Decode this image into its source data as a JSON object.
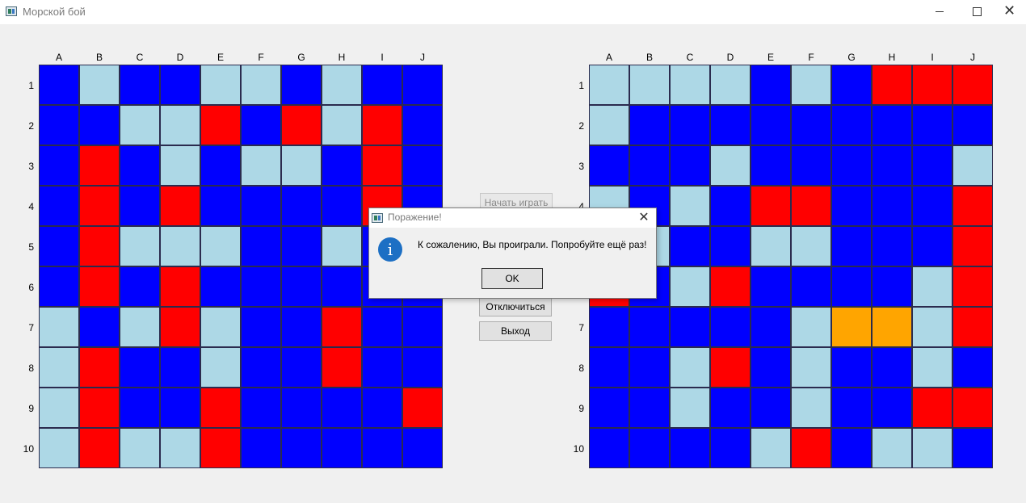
{
  "window": {
    "title": "Морской бой"
  },
  "colors": {
    "water": "#0000ff",
    "miss": "#add8e6",
    "hit": "#ff0000",
    "ship": "#ffa500",
    "background": "#f0f0f0",
    "info": "#1c6fc4"
  },
  "legend": {
    "W": "water",
    "M": "miss",
    "H": "hit",
    "S": "ship"
  },
  "columns": [
    "A",
    "B",
    "C",
    "D",
    "E",
    "F",
    "G",
    "H",
    "I",
    "J"
  ],
  "rows": [
    "1",
    "2",
    "3",
    "4",
    "5",
    "6",
    "7",
    "8",
    "9",
    "10"
  ],
  "left_board": {
    "grid": [
      "WMWWMMWMWW",
      "WWMMHWHMHW",
      "WHWMWMMWHW",
      "WHWHWWWWHW",
      "WHMMMWWMWW",
      "WHWHWWWWWW",
      "MWMHMWWHWW",
      "MHWWMWWHWW",
      "MHWWHWWWWH",
      "MHMMHWWWWW"
    ]
  },
  "right_board": {
    "grid": [
      "MMMMWMWHHH",
      "MWWWWWWWWW",
      "WWWMWWWWWM",
      "MWMWHHWWWH",
      "WMWWMMWWWH",
      "HWMHWWWWMH",
      "WWWWWMSSMH",
      "WWMHWMWWMW",
      "WWMWWMWWHH",
      "WWWWMHWMMW"
    ]
  },
  "buttons": {
    "start": "Начать играть",
    "disconnect": "Отключиться",
    "exit": "Выход"
  },
  "dialog": {
    "title": "Поражение!",
    "message": "К сожалению, Вы проиграли. Попробуйте ещё раз!",
    "ok": "OK",
    "icon": "info-icon"
  }
}
